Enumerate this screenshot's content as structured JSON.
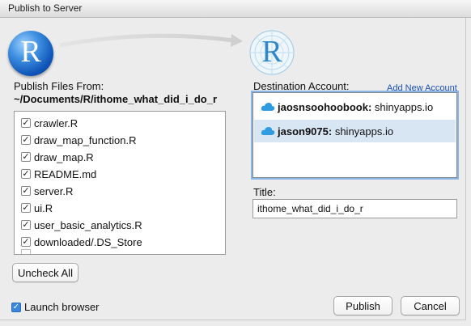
{
  "window": {
    "title": "Publish to Server"
  },
  "files_section": {
    "label": "Publish Files From:",
    "path": "~/Documents/R/ithome_what_did_i_do_r",
    "files": [
      {
        "name": "crawler.R",
        "checked": true
      },
      {
        "name": "draw_map_function.R",
        "checked": true
      },
      {
        "name": "draw_map.R",
        "checked": true
      },
      {
        "name": "README.md",
        "checked": true
      },
      {
        "name": "server.R",
        "checked": true
      },
      {
        "name": "ui.R",
        "checked": true
      },
      {
        "name": "user_basic_analytics.R",
        "checked": true
      },
      {
        "name": "downloaded/.DS_Store",
        "checked": true
      }
    ],
    "check_mark": "✓",
    "uncheck_all_label": "Uncheck All"
  },
  "logos": {
    "source_letter": "R",
    "destination_letter": "R"
  },
  "destination": {
    "label": "Destination Account:",
    "add_new_label": "Add New Account",
    "accounts": [
      {
        "user": "jaosnsoohoobook:",
        "server": "shinyapps.io",
        "selected": false
      },
      {
        "user": "jason9075:",
        "server": "shinyapps.io",
        "selected": true
      }
    ]
  },
  "title_field": {
    "label": "Title:",
    "value": "ithome_what_did_i_do_r"
  },
  "footer": {
    "launch_browser_label": "Launch browser",
    "launch_browser_checked": true,
    "publish_label": "Publish",
    "cancel_label": "Cancel"
  },
  "colors": {
    "accent": "#3a86dd",
    "selected_row": "#d8e5f3",
    "link": "#1c4fb8",
    "cloud": "#2f9be0"
  }
}
